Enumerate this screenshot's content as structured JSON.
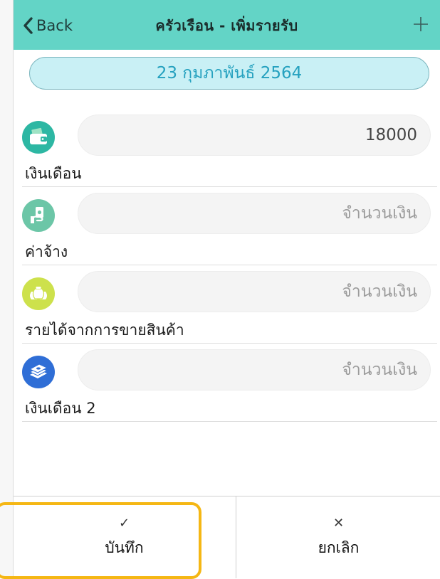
{
  "header": {
    "back_label": "Back",
    "title": "ครัวเรือน - เพิ่มรายรับ",
    "background": "#63d4c6"
  },
  "date": {
    "value": "23 กุมภาพันธ์ 2564",
    "text_color": "#25a1bf"
  },
  "income_items": [
    {
      "label": "เงินเดือน",
      "value": "18000",
      "placeholder": "จำนวนเงิน",
      "icon": "wallet-icon",
      "icon_color": "#2db7a3"
    },
    {
      "label": "ค่าจ้าง",
      "value": "",
      "placeholder": "จำนวนเงิน",
      "icon": "hand-money-icon",
      "icon_color": "#6cc6a7"
    },
    {
      "label": "รายได้จากการขายสินค้า",
      "value": "",
      "placeholder": "จำนวนเงิน",
      "icon": "money-bags-icon",
      "icon_color": "#cde14c"
    },
    {
      "label": "เงินเดือน 2",
      "value": "",
      "placeholder": "จำนวนเงิน",
      "icon": "cash-stack-icon",
      "icon_color": "#2f6ed6"
    }
  ],
  "footer": {
    "save_label": "บันทึก",
    "cancel_label": "ยกเลิก",
    "highlight_color": "#f5b714"
  }
}
